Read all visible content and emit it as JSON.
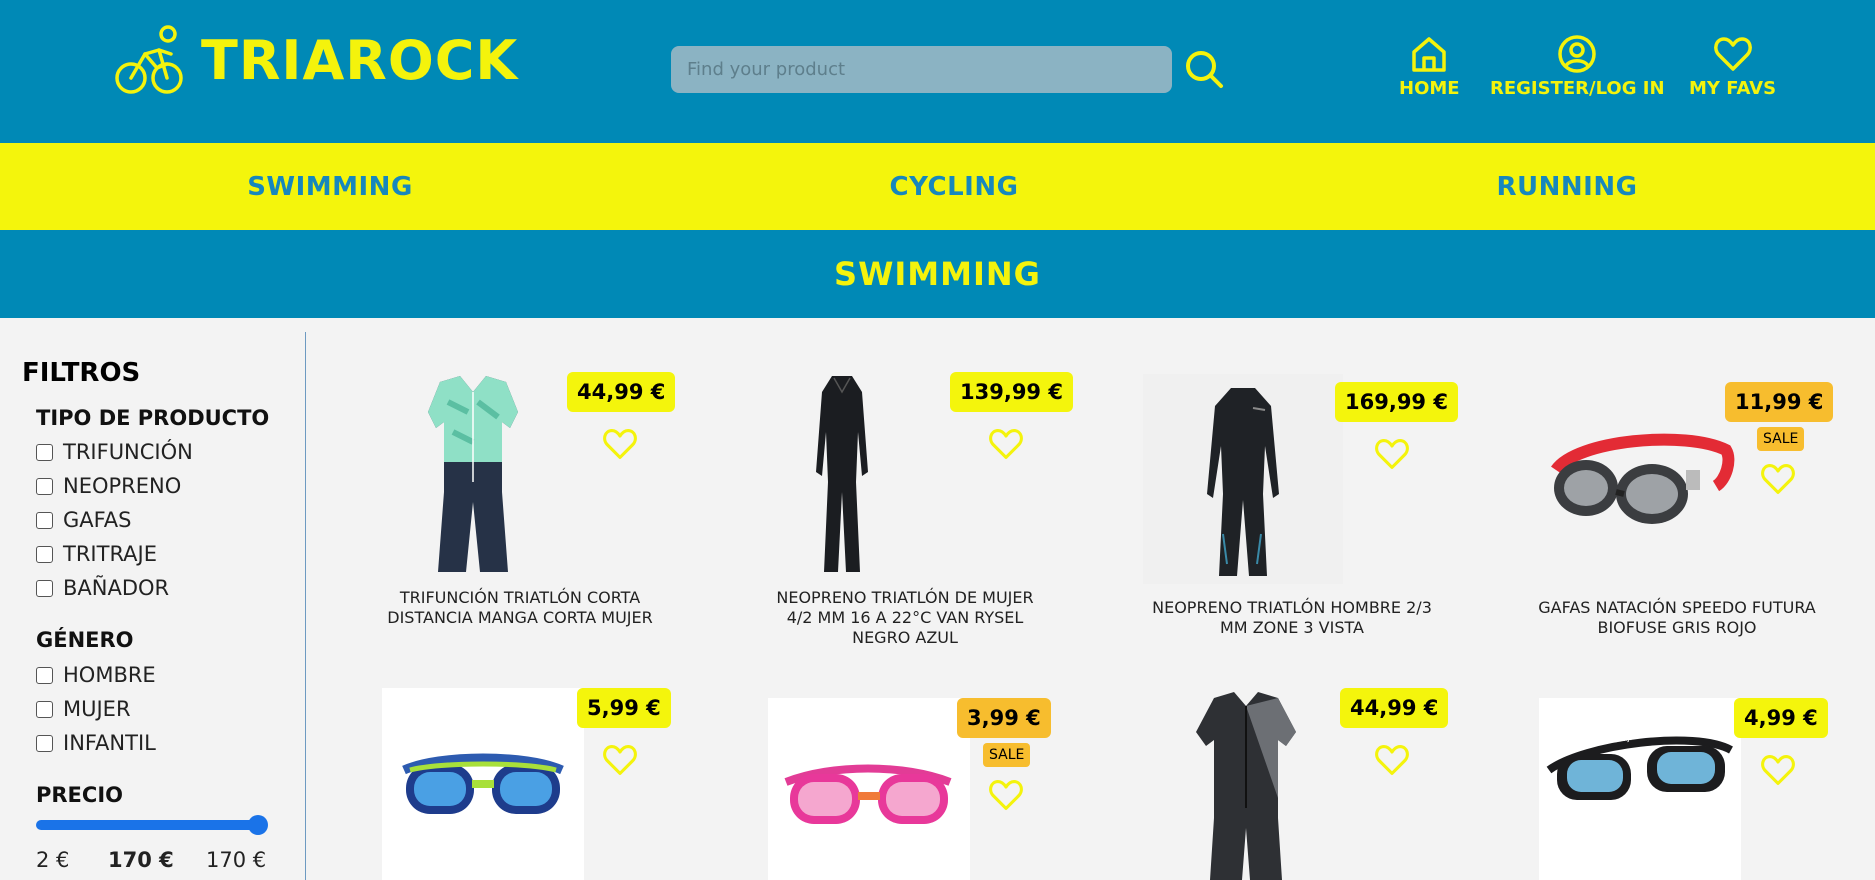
{
  "header": {
    "brand": "TRIAROCK",
    "search": {
      "placeholder": "Find your product"
    },
    "nav": [
      {
        "label": "HOME",
        "icon": "home-icon"
      },
      {
        "label": "REGISTER/LOG IN",
        "icon": "user-circle-icon"
      },
      {
        "label": "MY FAVS",
        "icon": "heart-icon"
      }
    ]
  },
  "categories": [
    "SWIMMING",
    "CYCLING",
    "RUNNING"
  ],
  "section_title": "SWIMMING",
  "filters": {
    "title": "FILTROS",
    "product_type": {
      "title": "TIPO DE PRODUCTO",
      "options": [
        "TRIFUNCIÓN",
        "NEOPRENO",
        "GAFAS",
        "TRITRAJE",
        "BAÑADOR"
      ]
    },
    "gender": {
      "title": "GÉNERO",
      "options": [
        "HOMBRE",
        "MUJER",
        "INFANTIL"
      ]
    },
    "price": {
      "title": "PRECIO",
      "min_label": "2 €",
      "current_label": "170 €",
      "max_label": "170 €",
      "value": 1.0
    }
  },
  "products": [
    {
      "name": "TRIFUNCIÓN TRIATLÓN CORTA DISTANCIA MANGA CORTA MUJER",
      "price": "44,99 €",
      "sale": false,
      "image": "trisuit-women"
    },
    {
      "name": "NEOPRENO TRIATLÓN DE MUJER 4/2 MM 16 A 22°C VAN RYSEL NEGRO AZUL",
      "price": "139,99 €",
      "sale": false,
      "image": "wetsuit-women"
    },
    {
      "name": "NEOPRENO TRIATLÓN HOMBRE 2/3 MM ZONE 3 VISTA",
      "price": "169,99 €",
      "sale": false,
      "image": "wetsuit-men"
    },
    {
      "name": "GAFAS NATACIÓN SPEEDO FUTURA BIOFUSE GRIS ROJO",
      "price": "11,99 €",
      "sale": true,
      "sale_label": "SALE",
      "image": "goggles-red"
    },
    {
      "name": "",
      "price": "5,99 €",
      "sale": false,
      "image": "goggles-blue-green"
    },
    {
      "name": "",
      "price": "3,99 €",
      "sale": true,
      "sale_label": "SALE",
      "image": "goggles-pink"
    },
    {
      "name": "",
      "price": "44,99 €",
      "sale": false,
      "image": "trisuit-men"
    },
    {
      "name": "",
      "price": "4,99 €",
      "sale": false,
      "image": "goggles-black"
    }
  ],
  "colors": {
    "header_bg": "#0089b6",
    "accent_yellow": "#f4f30c",
    "category_text": "#1787bd",
    "sale_orange": "#f7bd2e"
  }
}
